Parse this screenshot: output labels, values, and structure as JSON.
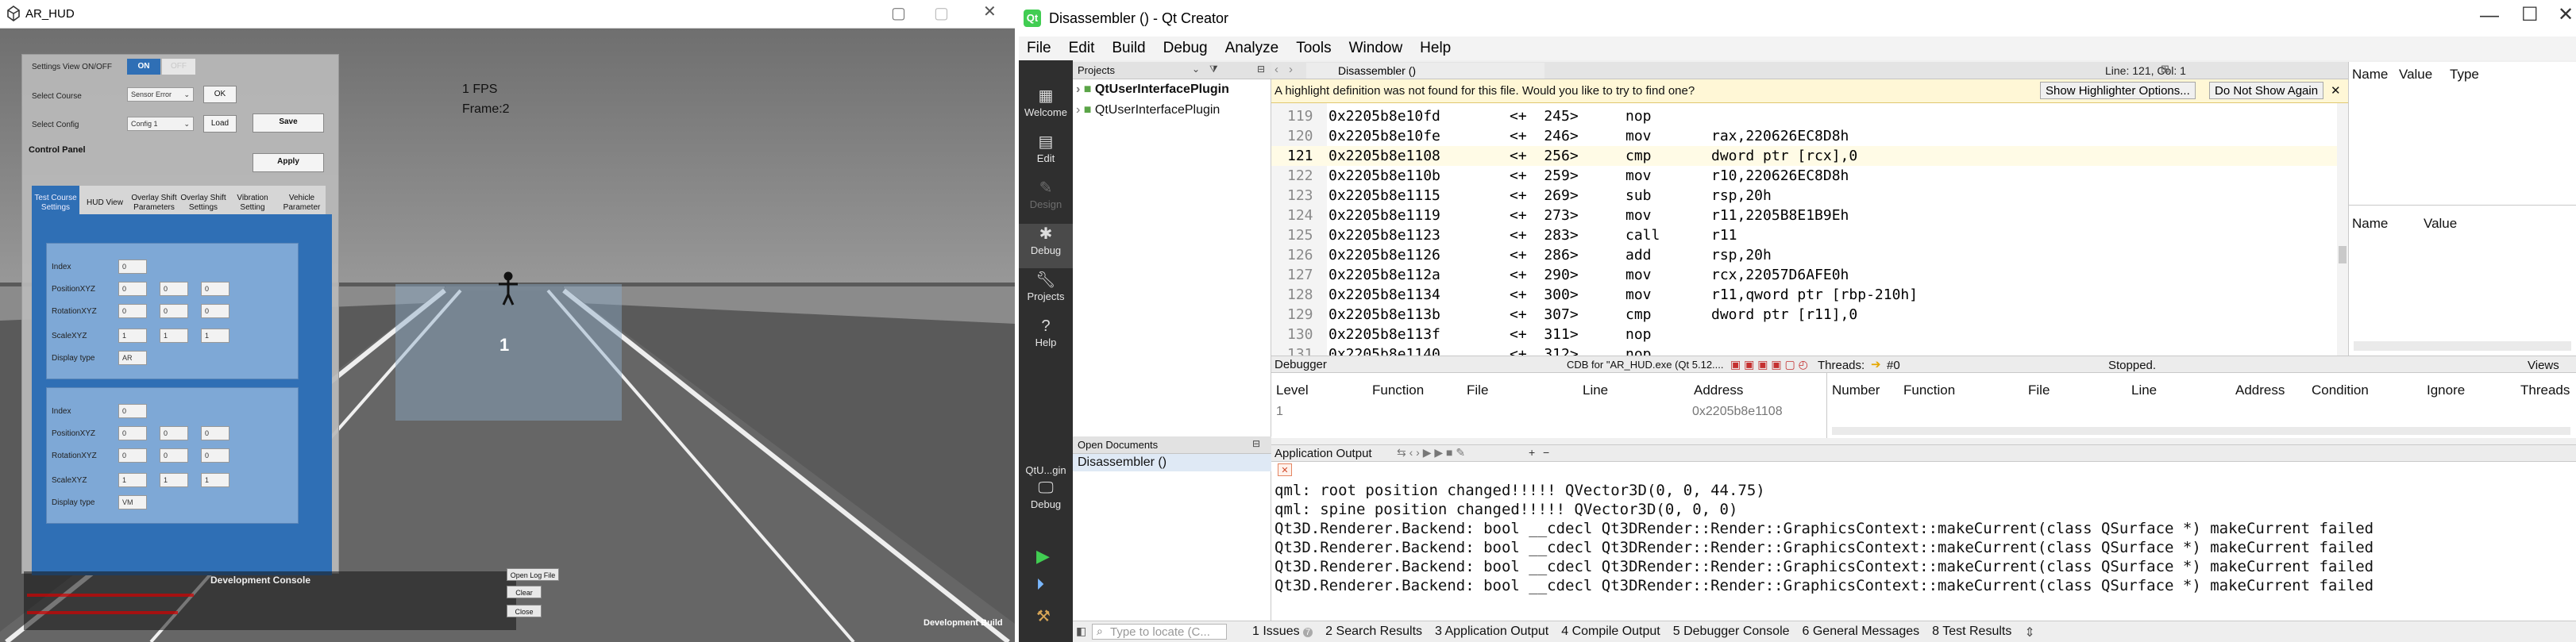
{
  "arhud": {
    "title": "AR_HUD",
    "fps": "1 FPS",
    "frame": "Frame:2",
    "road_marker": "1",
    "dev_build": "Development Build",
    "settings_view_label": "Settings View ON/OFF",
    "toggle_on": "ON",
    "toggle_off": "OFF",
    "select_course_label": "Select Course",
    "select_course_value": "Sensor Error",
    "ok_label": "OK",
    "select_config_label": "Select Config",
    "select_config_value": "Config 1",
    "load_label": "Load",
    "save_label": "Save",
    "control_panel_label": "Control Panel",
    "apply_label": "Apply",
    "tabs": [
      "Test Course Settings",
      "HUD View",
      "Overlay Shift Parameters",
      "Overlay Shift Settings",
      "Vibration Setting",
      "Vehicle Parameter"
    ],
    "cards": [
      {
        "index_label": "Index",
        "index_value": "0",
        "position_label": "PositionXYZ",
        "position": [
          "0",
          "0",
          "0"
        ],
        "rotation_label": "RotationXYZ",
        "rotation": [
          "0",
          "0",
          "0"
        ],
        "scale_label": "ScaleXYZ",
        "scale": [
          "1",
          "1",
          "1"
        ],
        "display_label": "Display type",
        "display_value": "AR"
      },
      {
        "index_label": "Index",
        "index_value": "0",
        "position_label": "PositionXYZ",
        "position": [
          "0",
          "0",
          "0"
        ],
        "rotation_label": "RotationXYZ",
        "rotation": [
          "0",
          "0",
          "0"
        ],
        "scale_label": "ScaleXYZ",
        "scale": [
          "1",
          "1",
          "1"
        ],
        "display_label": "Display type",
        "display_value": "VM"
      }
    ],
    "dev_console_title": "Development Console",
    "open_log_label": "Open Log File",
    "clear_label": "Clear",
    "close_label": "Close"
  },
  "qt": {
    "title": "Disassembler () - Qt Creator",
    "menu": [
      "File",
      "Edit",
      "Build",
      "Debug",
      "Analyze",
      "Tools",
      "Window",
      "Help"
    ],
    "modes": [
      "Welcome",
      "Edit",
      "Design",
      "Debug",
      "Projects",
      "Help"
    ],
    "kit_label": "QtU...gin",
    "kit_mode": "Debug",
    "projects_header": "Projects",
    "projects": [
      "QtUserInterfacePlugin",
      "QtUserInterfacePlugin"
    ],
    "open_docs_header": "Open Documents",
    "open_docs": [
      "Disassembler ()"
    ],
    "editor_tab": "Disassembler ()",
    "line_col": "Line: 121, Col: 1",
    "info_message": "A highlight definition was not found for this file. Would you like to try to find one?",
    "info_btn1": "Show Highlighter Options...",
    "info_btn2": "Do Not Show Again",
    "code_lines": [
      {
        "num": "119",
        "addr": "0x2205b8e10fd",
        "offset": "<+  245>",
        "mn": "nop",
        "op": ""
      },
      {
        "num": "120",
        "addr": "0x2205b8e10fe",
        "offset": "<+  246>",
        "mn": "mov",
        "op": "rax,220626EC8D8h"
      },
      {
        "num": "121",
        "addr": "0x2205b8e1108",
        "offset": "<+  256>",
        "mn": "cmp",
        "op": "dword ptr [rcx],0"
      },
      {
        "num": "122",
        "addr": "0x2205b8e110b",
        "offset": "<+  259>",
        "mn": "mov",
        "op": "r10,220626EC8D8h"
      },
      {
        "num": "123",
        "addr": "0x2205b8e1115",
        "offset": "<+  269>",
        "mn": "sub",
        "op": "rsp,20h"
      },
      {
        "num": "124",
        "addr": "0x2205b8e1119",
        "offset": "<+  273>",
        "mn": "mov",
        "op": "r11,2205B8E1B9Eh"
      },
      {
        "num": "125",
        "addr": "0x2205b8e1123",
        "offset": "<+  283>",
        "mn": "call",
        "op": "r11"
      },
      {
        "num": "126",
        "addr": "0x2205b8e1126",
        "offset": "<+  286>",
        "mn": "add",
        "op": "rsp,20h"
      },
      {
        "num": "127",
        "addr": "0x2205b8e112a",
        "offset": "<+  290>",
        "mn": "mov",
        "op": "rcx,22057D6AFE0h"
      },
      {
        "num": "128",
        "addr": "0x2205b8e1134",
        "offset": "<+  300>",
        "mn": "mov",
        "op": "r11,qword ptr [rbp-210h]"
      },
      {
        "num": "129",
        "addr": "0x2205b8e113b",
        "offset": "<+  307>",
        "mn": "cmp",
        "op": "dword ptr [r11],0"
      },
      {
        "num": "130",
        "addr": "0x2205b8e113f",
        "offset": "<+  311>",
        "mn": "nop",
        "op": ""
      },
      {
        "num": "131",
        "addr": "0x2205b8e1140",
        "offset": "<+  312>",
        "mn": "nop",
        "op": ""
      }
    ],
    "locals_cols": [
      "Name",
      "Value",
      "Type"
    ],
    "watch_cols": [
      "Name",
      "Value"
    ],
    "debugger_label": "Debugger",
    "debugger_engine": "CDB for \"AR_HUD.exe (Qt 5.12....",
    "threads_label": "Threads:",
    "thread_value": "#0",
    "stopped": "Stopped.",
    "views_label": "Views",
    "stack_cols": [
      "Level",
      "Function",
      "File",
      "Line",
      "Address"
    ],
    "stack_row": {
      "level": "1",
      "address": "0x2205b8e1108"
    },
    "break_cols": [
      "Number",
      "Function",
      "File",
      "Line",
      "Address",
      "Condition",
      "Ignore",
      "Threads"
    ],
    "app_output_label": "Application Output",
    "output_lines": [
      "qml: root position changed!!!!! QVector3D(0, 0, 44.75)",
      "qml: spine position changed!!!!! QVector3D(0, 0, 0)",
      "Qt3D.Renderer.Backend: bool __cdecl Qt3DRender::Render::GraphicsContext::makeCurrent(class QSurface *) makeCurrent failed",
      "Qt3D.Renderer.Backend: bool __cdecl Qt3DRender::Render::GraphicsContext::makeCurrent(class QSurface *) makeCurrent failed",
      "Qt3D.Renderer.Backend: bool __cdecl Qt3DRender::Render::GraphicsContext::makeCurrent(class QSurface *) makeCurrent failed",
      "Qt3D.Renderer.Backend: bool __cdecl Qt3DRender::Render::GraphicsContext::makeCurrent(class QSurface *) makeCurrent failed"
    ],
    "locate_placeholder": "Type to locate (C...",
    "bottom_tabs": [
      "1 Issues",
      "2 Search Results",
      "3 Application Output",
      "4 Compile Output",
      "5 Debugger Console",
      "6 General Messages",
      "8 Test Results"
    ],
    "issues_badge": "7"
  }
}
